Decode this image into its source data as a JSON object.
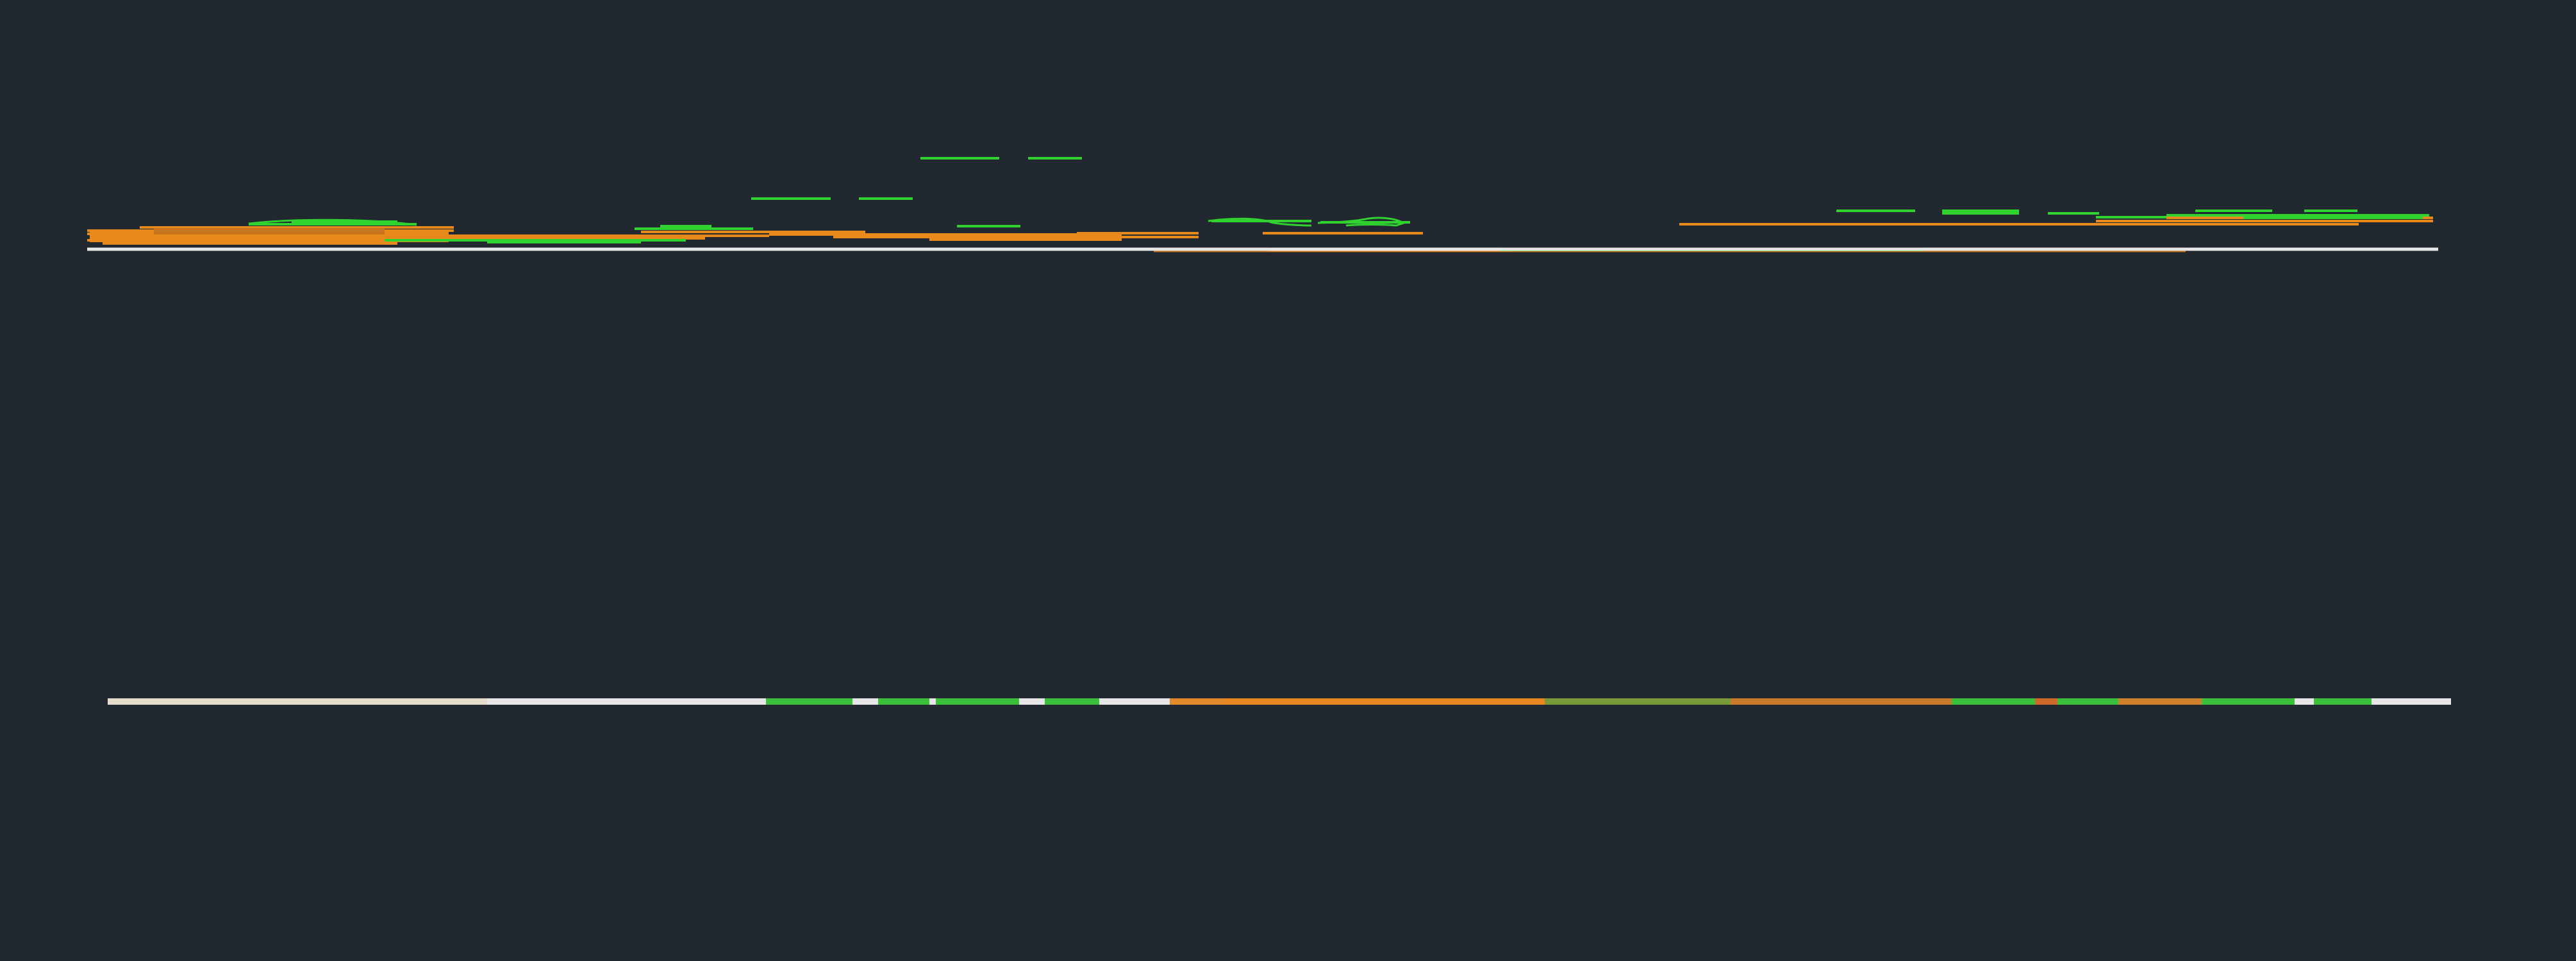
{
  "colors": {
    "background": "#212830",
    "baseline": "#e6e6e6",
    "green": "#2fd22f",
    "orange": "#e8891c",
    "orange_dark": "#c8731e",
    "green_mid": "#5aa83a"
  },
  "layer_names": [
    "baseline",
    "orange-segments",
    "green-segments"
  ],
  "minimap_band_colors": [
    "#e6dccb",
    "#e6e6e6",
    "#3cc03c",
    "#e6e6e6",
    "#3cc03c",
    "#3cc03c",
    "#e6e6e6",
    "#3cc03c",
    "#e6e6e6",
    "#e08a2a",
    "#e6871f",
    "#7a9a3a",
    "#c97a2a",
    "#3cc03c",
    "#cf6a2a",
    "#3cc03c",
    "#d0802a",
    "#3cc03c",
    "#e6e6e6",
    "#3cc03c",
    "#e6e6e6"
  ]
}
